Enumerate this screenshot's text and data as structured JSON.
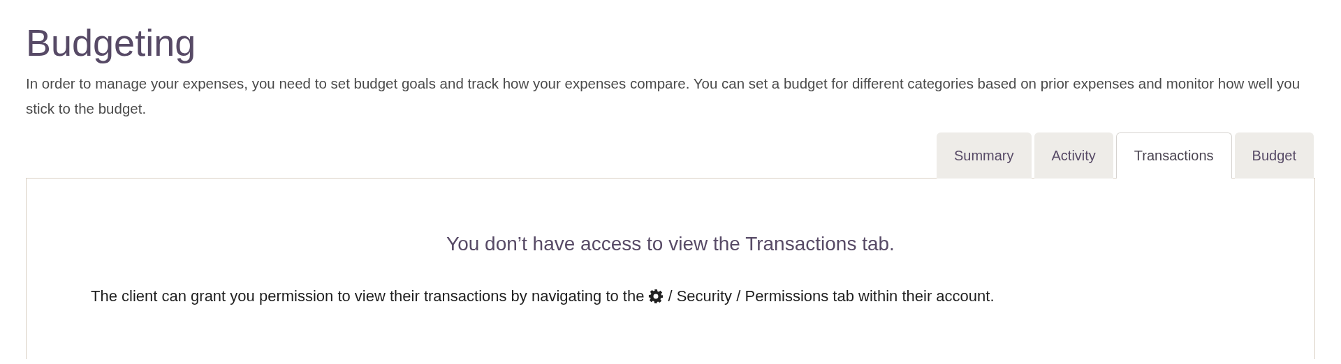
{
  "page": {
    "title": "Budgeting",
    "description": "In order to manage your expenses, you need to set budget goals and track how your expenses compare. You can set a budget for different categories based on prior expenses and monitor how well you stick to the budget."
  },
  "tabs": [
    {
      "label": "Summary",
      "selected": false
    },
    {
      "label": "Activity",
      "selected": false
    },
    {
      "label": "Transactions",
      "selected": true
    },
    {
      "label": "Budget",
      "selected": false
    }
  ],
  "panel": {
    "heading": "You don’t have access to view the Transactions tab.",
    "message_before": "The client can grant you permission to view their transactions by navigating to the",
    "message_after": "/ Security / Permissions tab within their account."
  }
}
